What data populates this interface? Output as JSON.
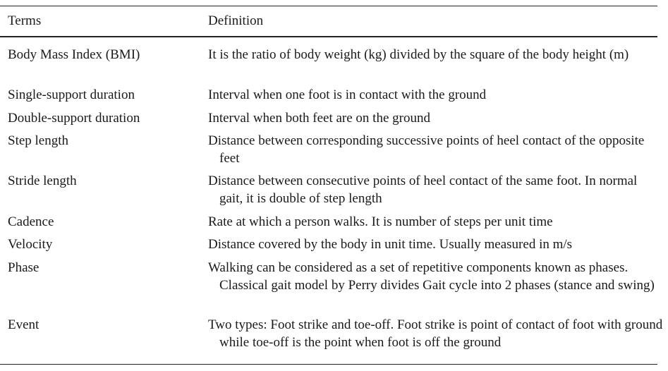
{
  "table": {
    "headers": {
      "term": "Terms",
      "definition": "Definition"
    },
    "rows": [
      {
        "term": "Body Mass Index (BMI)",
        "definition": "It is the ratio of body weight (kg) divided by the square of the body height (m)"
      },
      {
        "term": "Single-support duration",
        "definition": "Interval when one foot is in contact with the ground"
      },
      {
        "term": "Double-support duration",
        "definition": "Interval when both feet are on the ground"
      },
      {
        "term": "Step length",
        "definition": "Distance between corresponding successive points of heel contact of the opposite feet"
      },
      {
        "term": "Stride length",
        "definition": "Distance between consecutive points of heel contact of the same foot. In normal gait, it is double of step length"
      },
      {
        "term": "Cadence",
        "definition": "Rate at which a person walks. It is number of steps per unit time"
      },
      {
        "term": "Velocity",
        "definition": "Distance covered by the body in unit time. Usually measured in m/s"
      },
      {
        "term": "Phase",
        "definition": "Walking can be considered as a set of repetitive components known as phases. Classical gait model by Perry divides Gait cycle into 2 phases (stance and swing)"
      },
      {
        "term": "Event",
        "definition": "Two types: Foot strike and toe-off. Foot strike is point of contact of foot with ground while toe-off is the point when foot is off the ground"
      }
    ]
  }
}
